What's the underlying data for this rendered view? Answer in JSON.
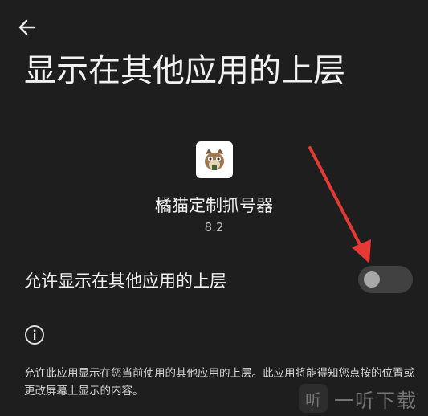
{
  "header": {
    "back_icon": "arrow-left-icon",
    "title": "显示在其他应用的上层"
  },
  "app": {
    "icon": "cat-app-icon",
    "name": "橘猫定制抓号器",
    "version": "8.2"
  },
  "permission": {
    "label": "允许显示在其他应用的上层",
    "enabled": false
  },
  "info": {
    "icon": "info-icon",
    "description": "允许此应用显示在您当前使用的其他应用的上层。此应用将能得知您点按的位置或更改屏幕上显示的内容。"
  },
  "annotation": {
    "color": "#e53935"
  },
  "watermark": {
    "text": "一听下载",
    "logo_glyph": "听"
  }
}
